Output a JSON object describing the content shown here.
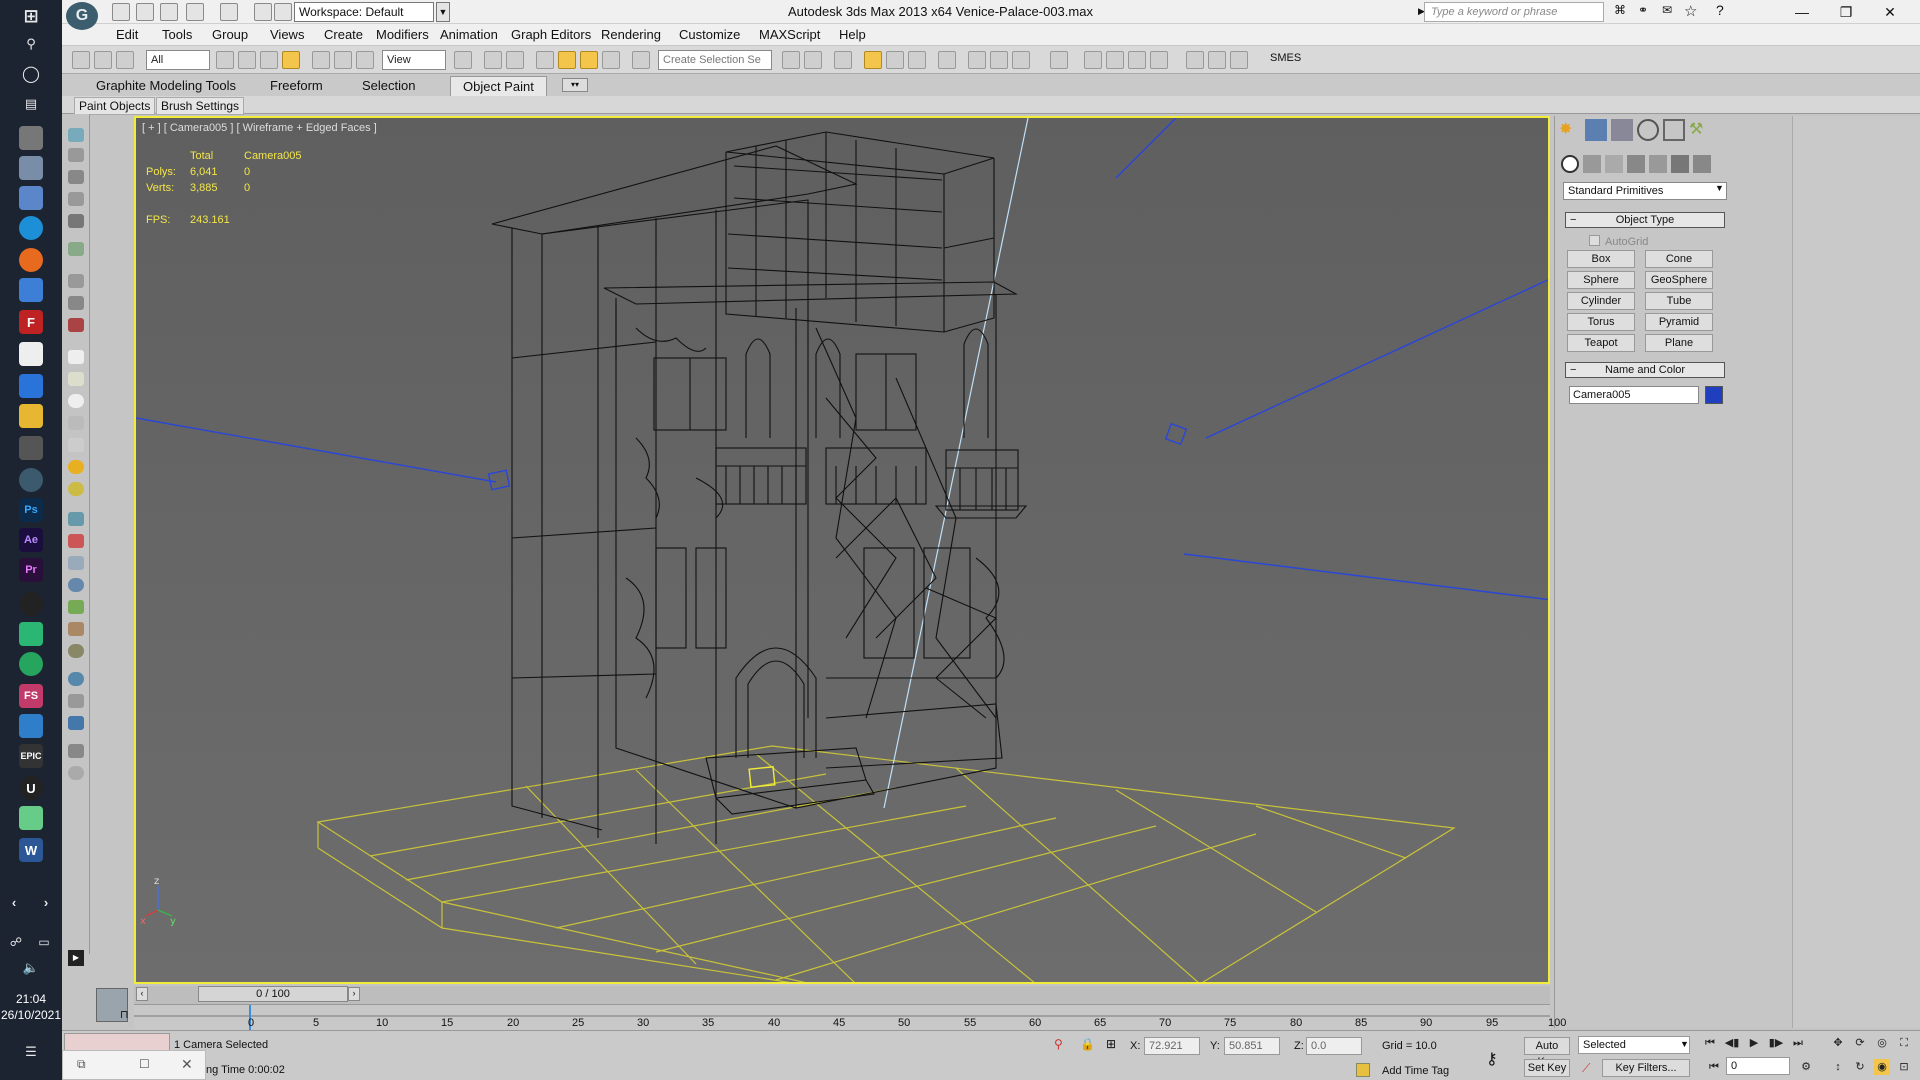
{
  "taskbar": {
    "clock_time": "21:04",
    "clock_date": "26/10/2021",
    "icons": [
      "windows-logo-icon",
      "search-icon",
      "cortana-icon",
      "task-view-icon",
      "app-icon",
      "app-icon",
      "app-icon",
      "edge-icon",
      "firefox-icon",
      "app-icon",
      "filezilla-icon",
      "store-icon",
      "mail-icon",
      "explorer-icon",
      "app-icon",
      "3dsmax-icon",
      "photoshop-icon",
      "aftereffects-icon",
      "premiere-icon",
      "obs-icon",
      "app-icon",
      "app-icon",
      "fs-icon",
      "app-icon",
      "epic-icon",
      "unreal-icon",
      "app-icon",
      "word-icon"
    ]
  },
  "titlebar": {
    "workspace": "Workspace: Default",
    "title": "Autodesk 3ds Max  2013 x64     Venice-Palace-003.max",
    "search_placeholder": "Type a keyword or phrase",
    "minimize": "—",
    "restore": "❐",
    "close": "✕"
  },
  "menu": [
    "Edit",
    "Tools",
    "Group",
    "Views",
    "Create",
    "Modifiers",
    "Animation",
    "Graph Editors",
    "Rendering",
    "Customize",
    "MAXScript",
    "Help"
  ],
  "toolbar": {
    "selection_filter": "All",
    "ref_coord": "View",
    "named_selection": "Create Selection Se",
    "smes_label": "SMES"
  },
  "ribbon": {
    "tabs": [
      "Graphite Modeling Tools",
      "Freeform",
      "Selection",
      "Object Paint"
    ],
    "active": "Object Paint",
    "subtabs": [
      "Paint Objects",
      "Brush Settings"
    ]
  },
  "viewport": {
    "label": "[ + ] [ Camera005 ] [ Wireframe + Edged Faces ]",
    "stats": {
      "total_label": "Total",
      "object_label": "Camera005",
      "polys_label": "Polys:",
      "polys_total": "6,041",
      "polys_obj": "0",
      "verts_label": "Verts:",
      "verts_total": "3,885",
      "verts_obj": "0",
      "fps_label": "FPS:",
      "fps_value": "243.161"
    },
    "axis_x": "x",
    "axis_y": "y",
    "axis_z": "z"
  },
  "command_panel": {
    "primitive_type": "Standard Primitives",
    "object_type_title": "Object Type",
    "autogrid": "AutoGrid",
    "primitives": [
      "Box",
      "Cone",
      "Sphere",
      "GeoSphere",
      "Cylinder",
      "Tube",
      "Torus",
      "Pyramid",
      "Teapot",
      "Plane"
    ],
    "name_color_title": "Name and Color",
    "object_name": "Camera005",
    "object_color": "#1f3fbf"
  },
  "timeline": {
    "frame_display": "0 / 100",
    "ticks": [
      "0",
      "5",
      "10",
      "15",
      "20",
      "25",
      "30",
      "35",
      "40",
      "45",
      "50",
      "55",
      "60",
      "65",
      "70",
      "75",
      "80",
      "85",
      "90",
      "95",
      "100"
    ]
  },
  "statusbar": {
    "selection_text": "1 Camera Selected",
    "render_time": "ng Time  0:00:02",
    "x_label": "X:",
    "x_value": "72.921",
    "y_label": "Y:",
    "y_value": "50.851",
    "z_label": "Z:",
    "z_value": "0.0",
    "grid": "Grid = 10.0",
    "add_time_tag": "Add Time Tag",
    "auto_key": "Auto Key",
    "set_key": "Set Key",
    "key_mode": "Selected",
    "key_filters": "Key Filters...",
    "current_frame": "0"
  },
  "colors": {
    "viewport_border": "#f1ec3a",
    "wire": "#111111",
    "grid_plane": "#c8c23a",
    "camera_wire": "#2a46d8"
  }
}
